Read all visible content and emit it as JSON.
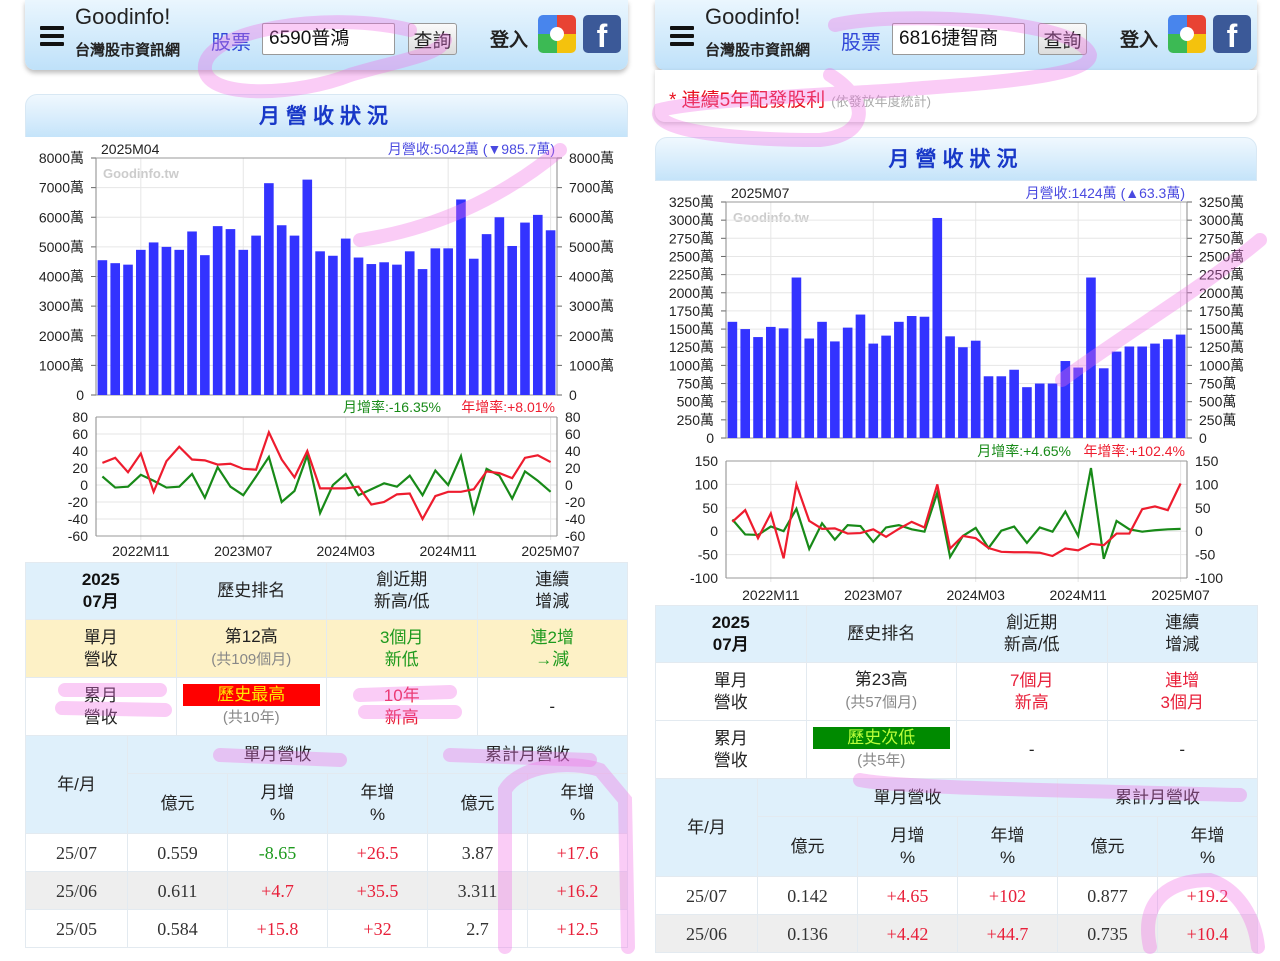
{
  "panels": [
    {
      "header": {
        "logo_top": "Goodinfo!",
        "logo_sub": "台灣股市資訊網",
        "stock_label": "股票",
        "stock_value": "6590普鴻",
        "query_button": "查詢",
        "login": "登入",
        "facebook": "f"
      },
      "section_title": "月營收狀況",
      "bar_annotation": {
        "month": "2025M04",
        "revenue": "月營收:5042萬 (▼985.7萬)",
        "watermark": "Goodinfo.tw"
      },
      "line_annotation": {
        "mom": "月增率:-16.35%",
        "yoy": "年增率:+8.01%"
      },
      "summary": {
        "headers": [
          "2025\n07月",
          "歷史排名",
          "創近期\n新高/低",
          "連續\n增減"
        ],
        "rows": [
          {
            "label": "單月\n營收",
            "rank": "第12高",
            "rank_sub": "(共109個月)",
            "recent": "3個月\n新低",
            "recent_color": "green",
            "streak": "連2增\n→減",
            "streak_color": "green"
          },
          {
            "label": "累月\n營收",
            "rank": "歷史最高",
            "rank_badge": "red",
            "rank_sub": "(共10年)",
            "recent": "10年\n新高",
            "recent_color": "red",
            "streak": "-",
            "streak_color": "none"
          }
        ]
      },
      "table": {
        "col_ym": "年/月",
        "group_single": "單月營收",
        "group_cum": "累計月營收",
        "sub_headers": [
          "億元",
          "月增\n%",
          "年增\n%",
          "億元",
          "年增\n%"
        ],
        "rows": [
          [
            "25/07",
            "0.559",
            "-8.65",
            "+26.5",
            "3.87",
            "+17.6"
          ],
          [
            "25/06",
            "0.611",
            "+4.7",
            "+35.5",
            "3.311",
            "+16.2"
          ],
          [
            "25/05",
            "0.584",
            "+15.8",
            "+32",
            "2.7",
            "+12.5"
          ]
        ]
      }
    },
    {
      "header": {
        "logo_top": "Goodinfo!",
        "logo_sub": "台灣股市資訊網",
        "stock_label": "股票",
        "stock_value": "6816捷智商",
        "query_button": "查詢",
        "login": "登入",
        "facebook": "f"
      },
      "notice": {
        "main": "* 連續5年配發股利",
        "sub": "(依發放年度統計)"
      },
      "section_title": "月營收狀況",
      "bar_annotation": {
        "month": "2025M07",
        "revenue": "月營收:1424萬 (▲63.3萬)",
        "watermark": "Goodinfo.tw"
      },
      "line_annotation": {
        "mom": "月增率:+4.65%",
        "yoy": "年增率:+102.4%"
      },
      "summary": {
        "headers": [
          "2025\n07月",
          "歷史排名",
          "創近期\n新高/低",
          "連續\n增減"
        ],
        "rows": [
          {
            "label": "單月\n營收",
            "rank": "第23高",
            "rank_sub": "(共57個月)",
            "recent": "7個月\n新高",
            "recent_color": "red",
            "streak": "連增\n3個月",
            "streak_color": "red"
          },
          {
            "label": "累月\n營收",
            "rank": "歷史次低",
            "rank_badge": "green",
            "rank_sub": "(共5年)",
            "recent": "-",
            "recent_color": "none",
            "streak": "-",
            "streak_color": "none"
          }
        ]
      },
      "table": {
        "col_ym": "年/月",
        "group_single": "單月營收",
        "group_cum": "累計月營收",
        "sub_headers": [
          "億元",
          "月增\n%",
          "年增\n%",
          "億元",
          "年增\n%"
        ],
        "rows": [
          [
            "25/07",
            "0.142",
            "+4.65",
            "+102",
            "0.877",
            "+19.2"
          ],
          [
            "25/06",
            "0.136",
            "+4.42",
            "+44.7",
            "0.735",
            "+10.4"
          ]
        ]
      }
    }
  ],
  "colors": {
    "bar": "#3333ff",
    "mom": "#188a18",
    "yoy": "#ee1c2e",
    "positive": "#e8203a",
    "negative": "#1e9a1e",
    "title": "#1838c8"
  },
  "chart_data": [
    {
      "type": "bar",
      "title": "6590普鴻 月營收",
      "unit": "萬",
      "x_ticks": [
        "2022M11",
        "2023M07",
        "2024M03",
        "2024M11",
        "2025M07"
      ],
      "x_tick_index": [
        3,
        11,
        19,
        27,
        35
      ],
      "ylim": [
        0,
        8000
      ],
      "y_step": 1000,
      "grid": true,
      "values": [
        4550,
        4450,
        4400,
        4900,
        5150,
        5000,
        4900,
        5520,
        4720,
        5700,
        5600,
        4900,
        5380,
        7150,
        5730,
        5380,
        7270,
        4850,
        4700,
        5280,
        4640,
        4420,
        4480,
        4400,
        4850,
        4250,
        4950,
        4950,
        6600,
        4600,
        5430,
        6000,
        5030,
        5820,
        6080,
        5560
      ]
    },
    {
      "type": "line",
      "title": "6590普鴻 月增率/年增率",
      "ylim": [
        -60,
        80
      ],
      "y_step": 20,
      "grid": true,
      "x_ticks": [
        "2022M11",
        "2023M07",
        "2024M03",
        "2024M11",
        "2025M07"
      ],
      "x_tick_index": [
        3,
        11,
        19,
        27,
        35
      ],
      "series": [
        {
          "name": "月增率",
          "values": [
            10,
            -3,
            -2,
            12,
            5,
            -3,
            -2,
            13,
            -15,
            21,
            -2,
            -12,
            10,
            33,
            -20,
            -7,
            35,
            -33,
            0,
            13,
            -12,
            -5,
            2,
            -2,
            11,
            -12,
            17,
            0,
            34,
            -32,
            19,
            11,
            -16,
            16,
            5,
            -8
          ]
        },
        {
          "name": "年增率",
          "values": [
            26,
            32,
            15,
            37,
            -8,
            28,
            45,
            30,
            29,
            24,
            25,
            19,
            18,
            62,
            30,
            9,
            40,
            -4,
            -4,
            -4,
            -2,
            -23,
            -20,
            -11,
            -10,
            -40,
            -13,
            -8,
            -8,
            -5,
            16,
            14,
            8,
            32,
            35,
            27
          ]
        }
      ]
    },
    {
      "type": "bar",
      "title": "6816捷智商 月營收",
      "unit": "萬",
      "x_ticks": [
        "2022M11",
        "2023M07",
        "2024M03",
        "2024M11",
        "2025M07"
      ],
      "x_tick_index": [
        3,
        11,
        19,
        27,
        35
      ],
      "ylim": [
        0,
        3250
      ],
      "y_step": 250,
      "grid": true,
      "values": [
        1600,
        1500,
        1390,
        1530,
        1510,
        2210,
        1370,
        1600,
        1330,
        1520,
        1700,
        1300,
        1410,
        1600,
        1680,
        1670,
        3030,
        1400,
        1250,
        1340,
        850,
        850,
        940,
        700,
        750,
        750,
        1060,
        970,
        2210,
        960,
        1190,
        1260,
        1260,
        1300,
        1360,
        1424
      ]
    },
    {
      "type": "line",
      "title": "6816捷智商 月增率/年增率",
      "ylim": [
        -100,
        150
      ],
      "y_step": 50,
      "grid": true,
      "x_ticks": [
        "2022M11",
        "2023M07",
        "2024M03",
        "2024M11",
        "2025M07"
      ],
      "x_tick_index": [
        3,
        11,
        19,
        27,
        35
      ],
      "series": [
        {
          "name": "月增率",
          "values": [
            25,
            -7,
            -8,
            10,
            0,
            48,
            -38,
            17,
            -18,
            13,
            11,
            -23,
            8,
            13,
            4,
            -1,
            82,
            -55,
            -10,
            7,
            -36,
            1,
            10,
            -25,
            8,
            -1,
            42,
            -10,
            135,
            -59,
            22,
            4,
            -1,
            2,
            4,
            5
          ]
        },
        {
          "name": "年增率",
          "values": [
            20,
            45,
            -15,
            38,
            -58,
            100,
            22,
            5,
            6,
            -5,
            -4,
            4,
            -12,
            5,
            20,
            8,
            100,
            -37,
            -10,
            -15,
            -36,
            -44,
            -45,
            -45,
            -46,
            -53,
            -37,
            -41,
            -27,
            -30,
            -5,
            -5,
            47,
            53,
            45,
            102
          ]
        }
      ]
    }
  ]
}
